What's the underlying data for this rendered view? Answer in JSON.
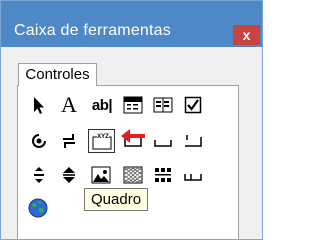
{
  "window": {
    "title": "Caixa de ferramentas",
    "close_glyph": "x"
  },
  "tabs": [
    {
      "label": "Controles",
      "active": true
    }
  ],
  "tools": [
    {
      "name": "pointer-tool-icon"
    },
    {
      "name": "label-tool-icon",
      "glyph": "A"
    },
    {
      "name": "textbox-tool-icon",
      "glyph": "ab|"
    },
    {
      "name": "combobox-tool-icon"
    },
    {
      "name": "listbox-tool-icon"
    },
    {
      "name": "checkbox-tool-icon"
    },
    {
      "name": "optionbutton-tool-icon"
    },
    {
      "name": "togglebutton-tool-icon"
    },
    {
      "name": "frame-tool-icon",
      "glyph": "XYZ"
    },
    {
      "name": "commandbutton-tool-icon"
    },
    {
      "name": "tabstrip-tool-icon"
    },
    {
      "name": "multipage-tool-icon"
    },
    {
      "name": "scrollbar-tool-icon"
    },
    {
      "name": "spinbutton-tool-icon"
    },
    {
      "name": "image-tool-icon"
    },
    {
      "name": "refedit-tool-icon"
    },
    {
      "name": "grid-tool-icon"
    },
    {
      "name": "calendar-tool-icon"
    },
    {
      "name": "globe-tool-icon"
    }
  ],
  "tooltip": {
    "text": "Quadro"
  },
  "colors": {
    "titlebar": "#4e88c6",
    "close": "#c74440",
    "arrow": "#e02020"
  }
}
